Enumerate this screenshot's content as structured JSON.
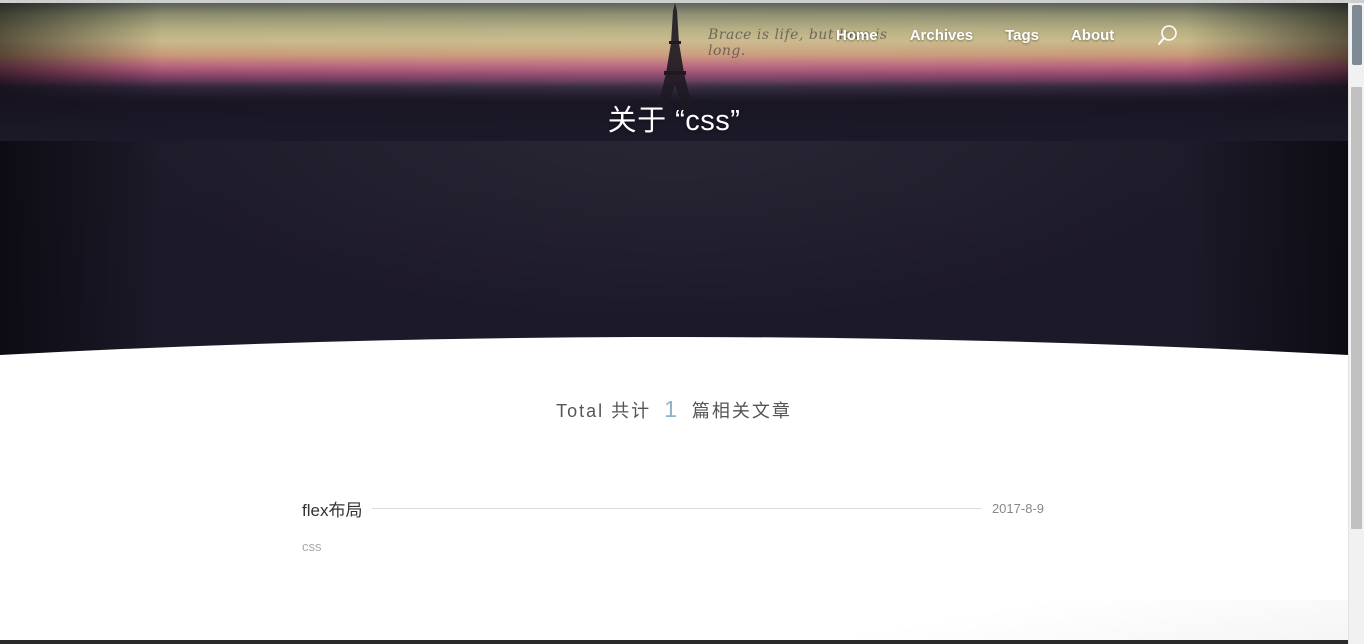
{
  "nav": {
    "items": [
      {
        "label": "Home"
      },
      {
        "label": "Archives"
      },
      {
        "label": "Tags"
      },
      {
        "label": "About"
      }
    ],
    "search_icon": "search-icon"
  },
  "hero": {
    "title": "关于 “css”",
    "script_text": "Brace is life, but love is long."
  },
  "summary": {
    "prefix": "Total 共计",
    "count": "1",
    "suffix": "篇相关文章"
  },
  "posts": [
    {
      "title": "flex布局",
      "date": "2017-8-9",
      "tag": "css"
    }
  ],
  "colors": {
    "hero_dark": "#1c1929",
    "count_accent": "#8fb1c9"
  }
}
